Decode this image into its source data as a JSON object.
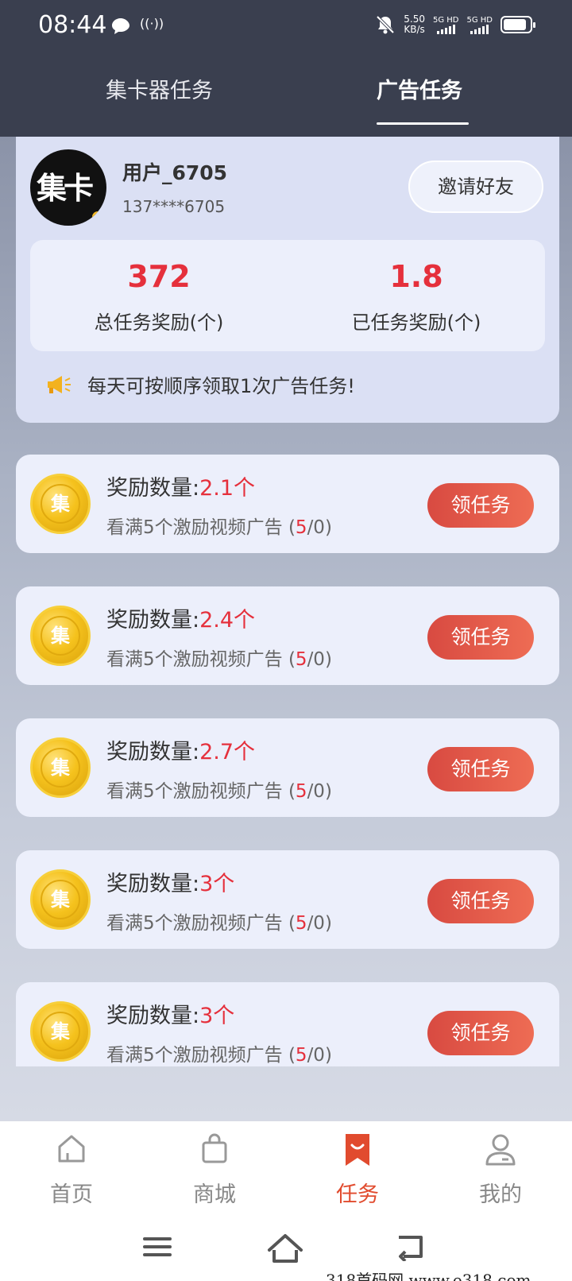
{
  "status_bar": {
    "time": "08:44",
    "speed_value": "5.50",
    "speed_unit": "KB/s",
    "sim1": "5G HD",
    "sim2": "5G HD"
  },
  "tabs": [
    {
      "label": "集卡器任务",
      "active": false
    },
    {
      "label": "广告任务",
      "active": true
    }
  ],
  "user": {
    "avatar_text": "集卡",
    "name": "用户_6705",
    "phone": "137****6705",
    "invite_label": "邀请好友"
  },
  "stats": [
    {
      "value": "372",
      "label": "总任务奖励(个)"
    },
    {
      "value": "1.8",
      "label": "已任务奖励(个)"
    }
  ],
  "notice": "每天可按顺序领取1次广告任务!",
  "tasks": [
    {
      "title_prefix": "奖励数量:",
      "amount": "2.1个",
      "desc_prefix": "看满5个激励视频广告 (",
      "progress_done": "5",
      "progress_rest": "/0)",
      "button": "领任务",
      "coin_char": "集"
    },
    {
      "title_prefix": "奖励数量:",
      "amount": "2.4个",
      "desc_prefix": "看满5个激励视频广告 (",
      "progress_done": "5",
      "progress_rest": "/0)",
      "button": "领任务",
      "coin_char": "集"
    },
    {
      "title_prefix": "奖励数量:",
      "amount": "2.7个",
      "desc_prefix": "看满5个激励视频广告 (",
      "progress_done": "5",
      "progress_rest": "/0)",
      "button": "领任务",
      "coin_char": "集"
    },
    {
      "title_prefix": "奖励数量:",
      "amount": "3个",
      "desc_prefix": "看满5个激励视频广告 (",
      "progress_done": "5",
      "progress_rest": "/0)",
      "button": "领任务",
      "coin_char": "集"
    },
    {
      "title_prefix": "奖励数量:",
      "amount": "3个",
      "desc_prefix": "看满5个激励视频广告 (",
      "progress_done": "5",
      "progress_rest": "/0)",
      "button": "领任务",
      "coin_char": "集"
    }
  ],
  "bottom_nav": [
    {
      "label": "首页",
      "icon": "home-icon",
      "active": false
    },
    {
      "label": "商城",
      "icon": "shopping-bag-icon",
      "active": false
    },
    {
      "label": "任务",
      "icon": "bookmark-icon",
      "active": true
    },
    {
      "label": "我的",
      "icon": "user-icon",
      "active": false
    }
  ],
  "watermark": "318首码网  www.e318.com",
  "colors": {
    "header_bg": "#3a3f4f",
    "accent_red": "#e5303c",
    "button_red": "#d84a41",
    "nav_active": "#e14b2e"
  }
}
